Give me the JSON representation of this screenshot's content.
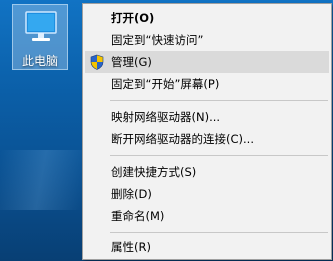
{
  "desktop": {
    "icon": {
      "label": "此电脑",
      "icon_name": "computer-icon"
    }
  },
  "context_menu": {
    "items": [
      {
        "label": "打开(O)",
        "bold": true
      },
      {
        "label": "固定到“快速访问”"
      },
      {
        "label": "管理(G)",
        "icon": "uac-shield-icon",
        "highlighted": true
      },
      {
        "label": "固定到“开始”屏幕(P)"
      },
      {
        "label": "映射网络驱动器(N)..."
      },
      {
        "label": "断开网络驱动器的连接(C)..."
      },
      {
        "label": "创建快捷方式(S)"
      },
      {
        "label": "删除(D)"
      },
      {
        "label": "重命名(M)"
      },
      {
        "label": "属性(R)"
      }
    ]
  },
  "colors": {
    "menu_background": "#f2f2f2",
    "highlight": "#dadada",
    "desktop_accent": "#0b5fa8",
    "shield_blue": "#2a64c8",
    "shield_yellow": "#f5c400"
  }
}
